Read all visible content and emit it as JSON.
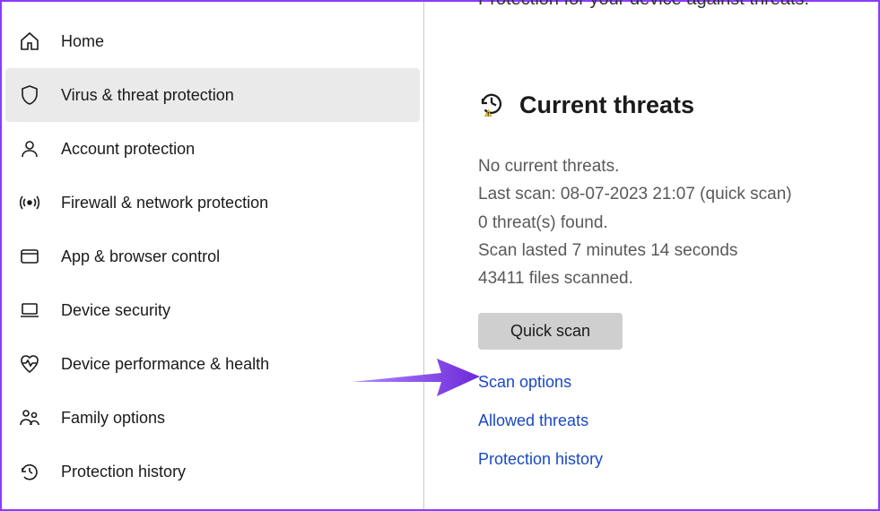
{
  "sidebar": {
    "items": [
      {
        "label": "Home"
      },
      {
        "label": "Virus & threat protection"
      },
      {
        "label": "Account protection"
      },
      {
        "label": "Firewall & network protection"
      },
      {
        "label": "App & browser control"
      },
      {
        "label": "Device security"
      },
      {
        "label": "Device performance & health"
      },
      {
        "label": "Family options"
      },
      {
        "label": "Protection history"
      }
    ],
    "active_index": 1
  },
  "main": {
    "partial_top": "Protection for your device against threats.",
    "section_title": "Current threats",
    "status": {
      "line_no_threats": "No current threats.",
      "line_last_scan": "Last scan: 08-07-2023 21:07 (quick scan)",
      "line_found": "0 threat(s) found.",
      "line_duration": "Scan lasted 7 minutes 14 seconds",
      "line_files": "43411 files scanned."
    },
    "quick_scan_label": "Quick scan",
    "links": {
      "scan_options": "Scan options",
      "allowed_threats": "Allowed threats",
      "protection_history": "Protection history"
    }
  },
  "colors": {
    "link": "#1a48c4",
    "accent_border": "#8a3cff",
    "arrow": "#7c3aed"
  }
}
